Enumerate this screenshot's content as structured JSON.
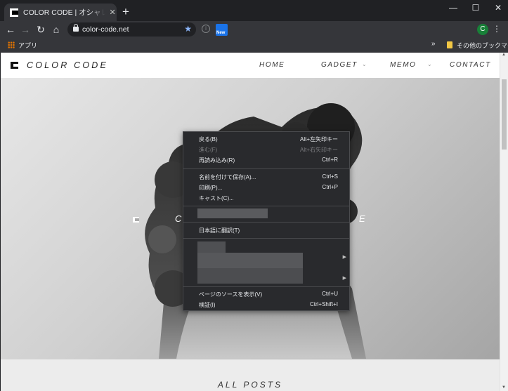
{
  "browser": {
    "tab_title": "COLOR CODE | オシャレなもの好き",
    "tab_close": "✕",
    "new_tab": "+",
    "window": {
      "minimize": "—",
      "maximize": "☐",
      "close": "✕"
    },
    "nav": {
      "back": "←",
      "forward": "→",
      "reload": "↻",
      "home": "⌂"
    },
    "url": "color-code.net",
    "star": "★",
    "info": "i",
    "extension_label": "New",
    "profile_initial": "C",
    "menu": "⋮",
    "bookmarks": {
      "apps": "アプリ",
      "overflow": "»",
      "other": "その他のブックマーク"
    }
  },
  "site": {
    "logo": "COLOR CODE",
    "nav": [
      {
        "label": "HOME"
      },
      {
        "label": "GADGET"
      },
      {
        "label": "MEMO"
      },
      {
        "label": "CONTACT"
      }
    ],
    "caret": "⌄",
    "hero_letters": {
      "left": "C",
      "right": "E"
    },
    "section_title": "ALL POSTS"
  },
  "context_menu": {
    "items": [
      {
        "label": "戻る(B)",
        "shortcut": "Alt+左矢印キー",
        "disabled": false
      },
      {
        "label": "進む(F)",
        "shortcut": "Alt+右矢印キー",
        "disabled": true
      },
      {
        "label": "再読み込み(R)",
        "shortcut": "Ctrl+R",
        "disabled": false
      },
      {
        "label": "名前を付けて保存(A)...",
        "shortcut": "Ctrl+S",
        "disabled": false
      },
      {
        "label": "印刷(P)...",
        "shortcut": "Ctrl+P",
        "disabled": false
      },
      {
        "label": "キャスト(C)...",
        "shortcut": "",
        "disabled": false
      },
      {
        "label": "日本語に翻訳(T)",
        "shortcut": "",
        "disabled": false
      },
      {
        "label": "ページのソースを表示(V)",
        "shortcut": "Ctrl+U",
        "disabled": false
      },
      {
        "label": "検証(I)",
        "shortcut": "Ctrl+Shift+I",
        "disabled": false
      }
    ],
    "submenu_arrow": "▶"
  },
  "scrollbar": {
    "up": "▲",
    "down": "▼"
  },
  "colors": {
    "chrome_dark": "#202124",
    "toolbar": "#35363a",
    "menu_bg": "#292a2d",
    "accent": "#8ab4f8"
  }
}
